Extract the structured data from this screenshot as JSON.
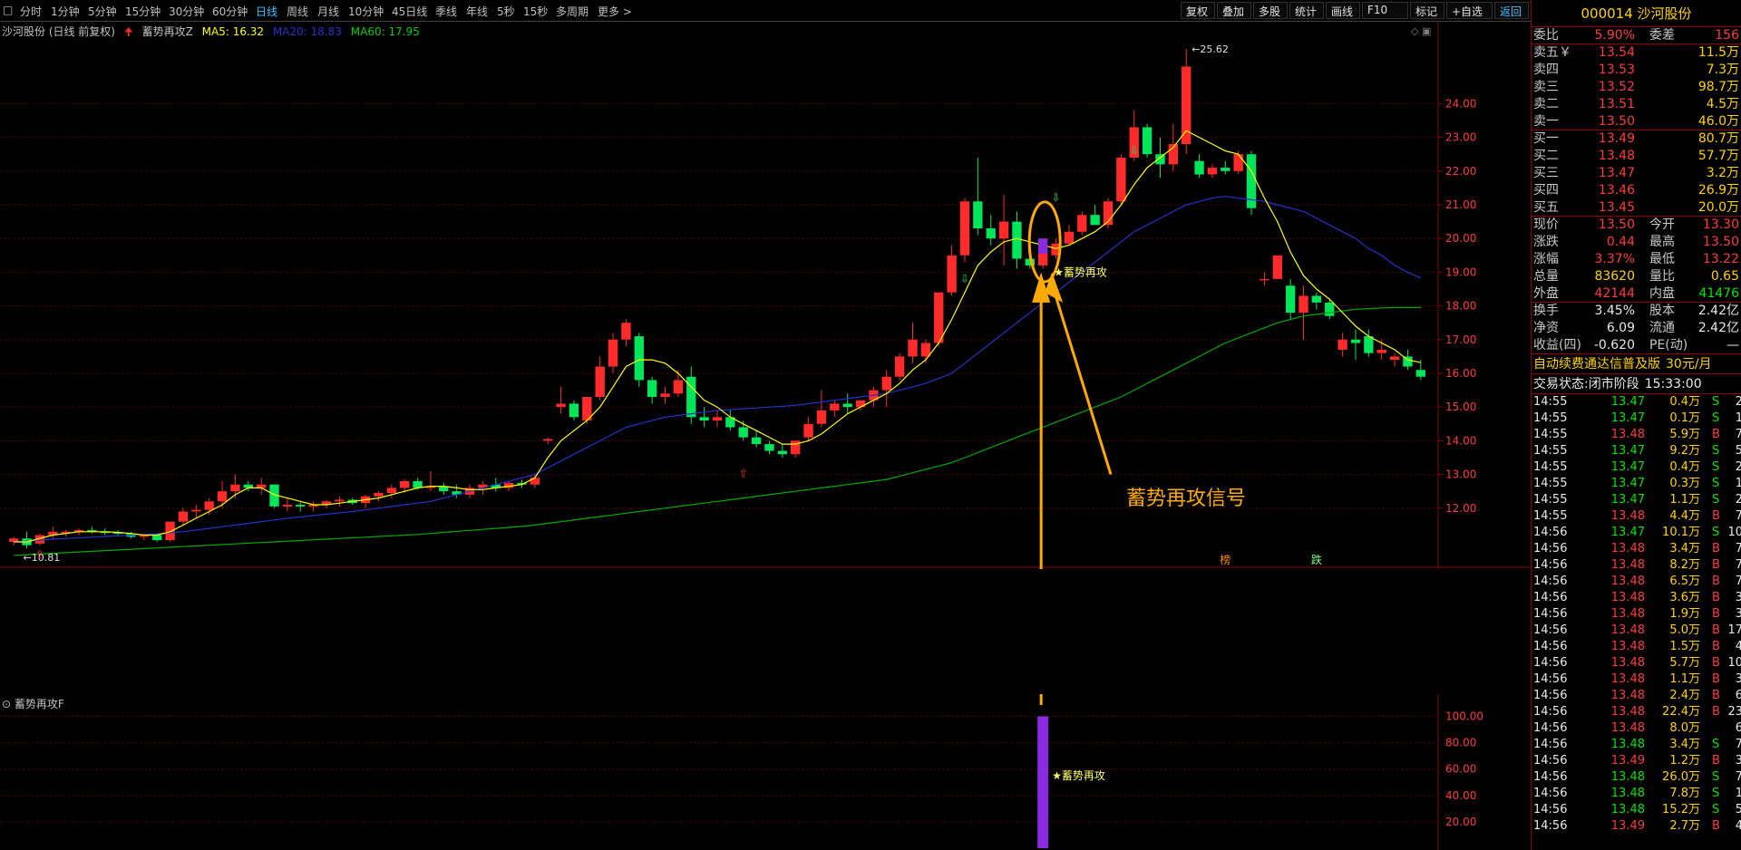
{
  "toolbar": {
    "menu_glyph": "□",
    "periods": [
      "分时",
      "1分钟",
      "5分钟",
      "15分钟",
      "30分钟",
      "60分钟",
      "日线",
      "周线",
      "月线",
      "10分钟",
      "45日线",
      "季线",
      "年线",
      "5秒",
      "15秒",
      "多周期",
      "更多 >"
    ],
    "active_period": "日线",
    "right_buttons": [
      "复权",
      "叠加",
      "多股",
      "统计",
      "画线",
      "F10",
      "标记",
      "+自选",
      "返回"
    ]
  },
  "legend": {
    "stock": "沙河股份 (日线 前复权)",
    "indicator": "蓄势再攻Z",
    "ma5": "MA5: 16.32",
    "ma20": "MA20: 18.83",
    "ma60": "MA60: 17.95"
  },
  "sub_legend": {
    "name": "蓄势再攻F"
  },
  "annotations": {
    "high_label": "25.62",
    "low_label": "10.81",
    "signal_main": "蓄势再攻",
    "signal_sub": "蓄势再攻",
    "callout": "蓄势再攻信号",
    "mark_bang": "榜",
    "mark_die": "跌"
  },
  "colors": {
    "up": "#ff2a2a",
    "down": "#00e65a",
    "ma5": "#ffff00",
    "ma20": "#2233cc",
    "ma60": "#00aa00",
    "signal": "#8a2be2",
    "callout": "#ffaa00"
  },
  "chart_data": {
    "type": "candlestick",
    "y_ticks": [
      "24.00",
      "23.00",
      "22.00",
      "21.00",
      "20.00",
      "19.00",
      "18.00",
      "17.00",
      "16.00",
      "15.00",
      "14.00",
      "13.00",
      "12.00"
    ],
    "sub_y_ticks": [
      "100.00",
      "80.00",
      "60.00",
      "40.00",
      "20.00"
    ],
    "candles": [
      [
        11.0,
        11.15,
        10.9,
        11.1
      ],
      [
        11.1,
        11.3,
        10.81,
        10.9
      ],
      [
        10.95,
        11.25,
        10.9,
        11.2
      ],
      [
        11.2,
        11.45,
        11.1,
        11.3
      ],
      [
        11.25,
        11.35,
        11.15,
        11.3
      ],
      [
        11.3,
        11.4,
        11.2,
        11.35
      ],
      [
        11.35,
        11.45,
        11.25,
        11.3
      ],
      [
        11.3,
        11.4,
        11.2,
        11.28
      ],
      [
        11.28,
        11.35,
        11.2,
        11.25
      ],
      [
        11.25,
        11.3,
        11.1,
        11.15
      ],
      [
        11.15,
        11.25,
        11.05,
        11.2
      ],
      [
        11.2,
        11.25,
        11.0,
        11.05
      ],
      [
        11.05,
        11.6,
        11.0,
        11.6
      ],
      [
        11.6,
        12.0,
        11.5,
        11.9
      ],
      [
        11.9,
        12.1,
        11.7,
        11.95
      ],
      [
        11.95,
        12.3,
        11.8,
        12.2
      ],
      [
        12.2,
        12.8,
        12.0,
        12.5
      ],
      [
        12.5,
        13.0,
        12.3,
        12.7
      ],
      [
        12.7,
        12.8,
        12.5,
        12.6
      ],
      [
        12.6,
        12.9,
        12.4,
        12.7
      ],
      [
        12.7,
        12.7,
        12.0,
        12.05
      ],
      [
        12.05,
        12.3,
        11.9,
        12.1
      ],
      [
        12.1,
        12.2,
        11.9,
        12.05
      ],
      [
        12.05,
        12.2,
        11.9,
        12.1
      ],
      [
        12.1,
        12.25,
        12.0,
        12.2
      ],
      [
        12.2,
        12.35,
        12.05,
        12.25
      ],
      [
        12.25,
        12.3,
        12.1,
        12.15
      ],
      [
        12.15,
        12.4,
        12.0,
        12.35
      ],
      [
        12.35,
        12.5,
        12.2,
        12.45
      ],
      [
        12.45,
        12.7,
        12.3,
        12.6
      ],
      [
        12.6,
        12.85,
        12.45,
        12.8
      ],
      [
        12.8,
        12.9,
        12.55,
        12.6
      ],
      [
        12.6,
        13.1,
        12.5,
        12.65
      ],
      [
        12.65,
        12.75,
        12.4,
        12.5
      ],
      [
        12.5,
        12.7,
        12.3,
        12.4
      ],
      [
        12.4,
        12.7,
        12.3,
        12.6
      ],
      [
        12.6,
        12.8,
        12.4,
        12.7
      ],
      [
        12.7,
        12.9,
        12.5,
        12.6
      ],
      [
        12.6,
        12.8,
        12.5,
        12.75
      ],
      [
        12.75,
        12.85,
        12.6,
        12.7
      ],
      [
        12.7,
        13.0,
        12.6,
        12.9
      ],
      [
        14.0,
        14.1,
        13.9,
        14.05
      ],
      [
        15.0,
        15.6,
        14.8,
        15.1
      ],
      [
        15.1,
        15.2,
        14.6,
        14.7
      ],
      [
        14.6,
        15.3,
        14.5,
        15.3
      ],
      [
        15.3,
        16.5,
        15.2,
        16.2
      ],
      [
        16.2,
        17.2,
        16.0,
        17.0
      ],
      [
        17.0,
        17.6,
        16.8,
        17.5
      ],
      [
        17.1,
        17.2,
        15.6,
        15.8
      ],
      [
        15.8,
        15.9,
        15.1,
        15.3
      ],
      [
        15.3,
        15.6,
        15.1,
        15.4
      ],
      [
        15.4,
        16.1,
        15.3,
        15.8
      ],
      [
        15.9,
        16.2,
        14.5,
        14.7
      ],
      [
        14.7,
        15.0,
        14.4,
        14.6
      ],
      [
        14.6,
        14.9,
        14.4,
        14.7
      ],
      [
        14.7,
        14.9,
        14.3,
        14.4
      ],
      [
        14.4,
        14.6,
        14.0,
        14.1
      ],
      [
        14.1,
        14.3,
        13.8,
        13.9
      ],
      [
        13.9,
        14.0,
        13.6,
        13.7
      ],
      [
        13.7,
        13.9,
        13.5,
        13.6
      ],
      [
        13.6,
        14.0,
        13.5,
        14.0
      ],
      [
        14.1,
        14.7,
        14.0,
        14.5
      ],
      [
        14.5,
        15.5,
        14.4,
        14.9
      ],
      [
        14.9,
        15.2,
        14.7,
        15.1
      ],
      [
        15.1,
        15.4,
        14.8,
        15.0
      ],
      [
        15.0,
        15.2,
        14.9,
        15.2
      ],
      [
        15.2,
        15.6,
        15.0,
        15.5
      ],
      [
        15.5,
        16.1,
        15.0,
        15.9
      ],
      [
        15.9,
        16.6,
        15.8,
        16.5
      ],
      [
        16.5,
        17.5,
        16.3,
        17.0
      ],
      [
        16.5,
        17.0,
        16.3,
        16.9
      ],
      [
        16.9,
        18.4,
        16.8,
        18.4
      ],
      [
        18.4,
        19.8,
        18.3,
        19.5
      ],
      [
        19.5,
        21.2,
        19.3,
        21.1
      ],
      [
        21.1,
        22.4,
        20.1,
        20.3
      ],
      [
        20.3,
        20.7,
        19.8,
        20.0
      ],
      [
        20.0,
        21.3,
        19.2,
        20.5
      ],
      [
        20.5,
        20.8,
        19.1,
        19.4
      ],
      [
        19.4,
        19.5,
        19.1,
        19.2
      ],
      [
        19.2,
        20.0,
        19.1,
        19.8
      ],
      [
        19.5,
        20.0,
        19.4,
        19.85
      ],
      [
        19.85,
        20.4,
        19.8,
        20.2
      ],
      [
        20.2,
        20.8,
        20.1,
        20.7
      ],
      [
        20.7,
        21.0,
        20.5,
        20.4
      ],
      [
        20.4,
        21.2,
        20.3,
        21.1
      ],
      [
        21.1,
        22.5,
        21.0,
        22.4
      ],
      [
        22.4,
        23.8,
        22.3,
        23.3
      ],
      [
        23.3,
        23.4,
        22.4,
        22.5
      ],
      [
        22.5,
        23.0,
        21.8,
        22.2
      ],
      [
        22.2,
        23.4,
        22.0,
        22.8
      ],
      [
        22.8,
        25.62,
        22.5,
        25.1
      ],
      [
        22.3,
        22.5,
        21.8,
        21.9
      ],
      [
        21.9,
        22.2,
        21.8,
        22.1
      ],
      [
        22.1,
        22.3,
        21.9,
        22.0
      ],
      [
        22.0,
        22.6,
        21.9,
        22.5
      ],
      [
        22.5,
        22.6,
        20.7,
        20.9
      ],
      [
        18.8,
        19.0,
        18.6,
        18.8
      ],
      [
        18.8,
        19.2,
        18.8,
        19.5
      ],
      [
        18.6,
        18.8,
        17.6,
        17.8
      ],
      [
        17.8,
        18.6,
        17.0,
        18.3
      ],
      [
        18.3,
        18.4,
        17.9,
        18.1
      ],
      [
        18.1,
        18.2,
        17.6,
        17.7
      ],
      [
        16.7,
        17.2,
        16.5,
        17.0
      ],
      [
        17.0,
        17.3,
        16.4,
        16.9
      ],
      [
        17.1,
        17.3,
        16.5,
        16.6
      ],
      [
        16.6,
        17.0,
        16.4,
        16.7
      ],
      [
        16.4,
        16.6,
        16.2,
        16.5
      ],
      [
        16.5,
        16.7,
        16.1,
        16.2
      ],
      [
        16.1,
        16.4,
        15.8,
        15.9
      ]
    ],
    "ma5": [
      11.0,
      11.0,
      11.1,
      11.2,
      11.25,
      11.3,
      11.3,
      11.3,
      11.28,
      11.25,
      11.2,
      11.2,
      11.3,
      11.5,
      11.7,
      11.9,
      12.1,
      12.4,
      12.6,
      12.6,
      12.4,
      12.3,
      12.2,
      12.1,
      12.1,
      12.15,
      12.2,
      12.25,
      12.3,
      12.4,
      12.5,
      12.6,
      12.65,
      12.65,
      12.6,
      12.55,
      12.55,
      12.6,
      12.65,
      12.7,
      12.9,
      13.5,
      14.0,
      14.3,
      14.6,
      15.0,
      15.6,
      16.2,
      16.4,
      16.4,
      16.3,
      16.0,
      15.6,
      15.2,
      15.0,
      14.7,
      14.5,
      14.3,
      14.1,
      13.9,
      13.9,
      14.0,
      14.2,
      14.5,
      14.8,
      15.0,
      15.2,
      15.4,
      15.7,
      16.1,
      16.4,
      16.9,
      17.6,
      18.4,
      19.2,
      19.6,
      19.9,
      20.0,
      19.9,
      19.8,
      19.7,
      19.8,
      20.0,
      20.2,
      20.5,
      21.0,
      21.6,
      22.1,
      22.4,
      22.7,
      23.2,
      23.0,
      22.8,
      22.6,
      22.5,
      22.0,
      21.2,
      20.5,
      19.6,
      18.9,
      18.5,
      18.2,
      17.8,
      17.4,
      17.1,
      16.9,
      16.7,
      16.4,
      16.32
    ],
    "ma20": [
      11.0,
      11.02,
      11.05,
      11.08,
      11.1,
      11.12,
      11.14,
      11.16,
      11.18,
      11.2,
      11.22,
      11.24,
      11.27,
      11.3,
      11.35,
      11.4,
      11.45,
      11.5,
      11.55,
      11.6,
      11.65,
      11.7,
      11.74,
      11.78,
      11.82,
      11.86,
      11.9,
      11.95,
      12.0,
      12.05,
      12.1,
      12.15,
      12.2,
      12.3,
      12.4,
      12.5,
      12.6,
      12.7,
      12.8,
      12.9,
      13.0,
      13.2,
      13.4,
      13.6,
      13.8,
      14.0,
      14.2,
      14.4,
      14.5,
      14.6,
      14.7,
      14.75,
      14.8,
      14.85,
      14.9,
      14.92,
      14.95,
      14.97,
      15.0,
      15.02,
      15.05,
      15.1,
      15.15,
      15.2,
      15.25,
      15.3,
      15.35,
      15.4,
      15.5,
      15.6,
      15.7,
      15.85,
      16.0,
      16.3,
      16.6,
      16.9,
      17.2,
      17.5,
      17.8,
      18.1,
      18.4,
      18.7,
      19.0,
      19.3,
      19.6,
      19.9,
      20.2,
      20.4,
      20.6,
      20.8,
      21.0,
      21.1,
      21.2,
      21.25,
      21.2,
      21.15,
      21.1,
      21.0,
      20.9,
      20.8,
      20.6,
      20.4,
      20.2,
      20.0,
      19.7,
      19.5,
      19.2,
      19.0,
      18.83
    ],
    "ma60": [
      10.6,
      10.62,
      10.64,
      10.66,
      10.68,
      10.7,
      10.72,
      10.74,
      10.76,
      10.78,
      10.8,
      10.82,
      10.84,
      10.86,
      10.88,
      10.9,
      10.92,
      10.94,
      10.96,
      10.98,
      11.0,
      11.02,
      11.04,
      11.06,
      11.08,
      11.1,
      11.12,
      11.14,
      11.16,
      11.18,
      11.2,
      11.22,
      11.25,
      11.28,
      11.31,
      11.34,
      11.37,
      11.4,
      11.43,
      11.46,
      11.5,
      11.55,
      11.6,
      11.65,
      11.7,
      11.75,
      11.8,
      11.85,
      11.9,
      11.95,
      12.0,
      12.05,
      12.1,
      12.15,
      12.2,
      12.25,
      12.3,
      12.35,
      12.4,
      12.45,
      12.5,
      12.55,
      12.6,
      12.65,
      12.7,
      12.75,
      12.8,
      12.85,
      12.95,
      13.05,
      13.15,
      13.25,
      13.35,
      13.5,
      13.65,
      13.8,
      13.95,
      14.1,
      14.25,
      14.4,
      14.55,
      14.7,
      14.85,
      15.0,
      15.15,
      15.3,
      15.5,
      15.7,
      15.9,
      16.1,
      16.3,
      16.5,
      16.7,
      16.9,
      17.05,
      17.2,
      17.35,
      17.5,
      17.6,
      17.7,
      17.75,
      17.8,
      17.85,
      17.9,
      17.92,
      17.94,
      17.95,
      17.95,
      17.95
    ],
    "signal_bar_value": 100
  },
  "panel": {
    "title": "000014 沙河股份",
    "weibi": {
      "label": "委比",
      "value": "5.90%",
      "label2": "委差",
      "value2": "156"
    },
    "asks": [
      {
        "label": "卖五￥",
        "price": "13.54",
        "vol": "11.5万"
      },
      {
        "label": "卖四",
        "price": "13.53",
        "vol": "7.3万"
      },
      {
        "label": "卖三",
        "price": "13.52",
        "vol": "98.7万"
      },
      {
        "label": "卖二",
        "price": "13.51",
        "vol": "4.5万"
      },
      {
        "label": "卖一",
        "price": "13.50",
        "vol": "46.0万"
      }
    ],
    "bids": [
      {
        "label": "买一",
        "price": "13.49",
        "vol": "80.7万"
      },
      {
        "label": "买二",
        "price": "13.48",
        "vol": "57.7万"
      },
      {
        "label": "买三",
        "price": "13.47",
        "vol": "3.2万"
      },
      {
        "label": "买四",
        "price": "13.46",
        "vol": "26.9万"
      },
      {
        "label": "买五",
        "price": "13.45",
        "vol": "20.0万"
      }
    ],
    "quote": [
      {
        "l1": "现价",
        "v1": "13.50",
        "l2": "今开",
        "v2": "13.30",
        "c1": "red",
        "c2": "red"
      },
      {
        "l1": "涨跌",
        "v1": "0.44",
        "l2": "最高",
        "v2": "13.50",
        "c1": "red",
        "c2": "red"
      },
      {
        "l1": "涨幅",
        "v1": "3.37%",
        "l2": "最低",
        "v2": "13.22",
        "c1": "red",
        "c2": "red"
      },
      {
        "l1": "总量",
        "v1": "83620",
        "l2": "量比",
        "v2": "0.65",
        "c1": "yellow",
        "c2": "yellow"
      },
      {
        "l1": "外盘",
        "v1": "42144",
        "l2": "内盘",
        "v2": "41476",
        "c1": "red",
        "c2": "green"
      }
    ],
    "fund": [
      {
        "l1": "换手",
        "v1": "3.45%",
        "l2": "股本",
        "v2": "2.42亿"
      },
      {
        "l1": "净资",
        "v1": "6.09",
        "l2": "流通",
        "v2": "2.42亿"
      },
      {
        "l1": "收益(四)",
        "v1": "-0.620",
        "l2": "PE(动)",
        "v2": "—"
      }
    ],
    "promo": {
      "text": "自动续费通达信普及版",
      "price": "30元/月"
    },
    "status": {
      "label": "交易状态:",
      "value": "闭市阶段",
      "time": "15:33:00"
    },
    "ticks": [
      [
        "14:55",
        "13.47",
        "0.4万",
        "S",
        "2",
        "green"
      ],
      [
        "14:55",
        "13.47",
        "0.1万",
        "S",
        "1",
        "green"
      ],
      [
        "14:55",
        "13.48",
        "5.9万",
        "B",
        "7",
        "red"
      ],
      [
        "14:55",
        "13.47",
        "9.2万",
        "S",
        "5",
        "green"
      ],
      [
        "14:55",
        "13.47",
        "0.4万",
        "S",
        "2",
        "green"
      ],
      [
        "14:55",
        "13.47",
        "0.3万",
        "S",
        "1",
        "green"
      ],
      [
        "14:55",
        "13.47",
        "1.1万",
        "S",
        "2",
        "green"
      ],
      [
        "14:55",
        "13.48",
        "4.4万",
        "B",
        "7",
        "red"
      ],
      [
        "14:56",
        "13.47",
        "10.1万",
        "S",
        "10",
        "green"
      ],
      [
        "14:56",
        "13.48",
        "3.4万",
        "B",
        "7",
        "red"
      ],
      [
        "14:56",
        "13.48",
        "8.2万",
        "B",
        "7",
        "red"
      ],
      [
        "14:56",
        "13.48",
        "6.5万",
        "B",
        "7",
        "red"
      ],
      [
        "14:56",
        "13.48",
        "3.6万",
        "B",
        "3",
        "red"
      ],
      [
        "14:56",
        "13.48",
        "1.9万",
        "B",
        "3",
        "red"
      ],
      [
        "14:56",
        "13.48",
        "5.0万",
        "B",
        "17",
        "red"
      ],
      [
        "14:56",
        "13.48",
        "1.5万",
        "B",
        "4",
        "red"
      ],
      [
        "14:56",
        "13.48",
        "5.7万",
        "B",
        "10",
        "red"
      ],
      [
        "14:56",
        "13.48",
        "1.1万",
        "B",
        "3",
        "red"
      ],
      [
        "14:56",
        "13.48",
        "2.4万",
        "B",
        "6",
        "red"
      ],
      [
        "14:56",
        "13.48",
        "22.4万",
        "B",
        "23",
        "red"
      ],
      [
        "14:56",
        "13.48",
        "8.0万",
        "",
        "6",
        "red"
      ],
      [
        "14:56",
        "13.48",
        "3.4万",
        "S",
        "7",
        "green"
      ],
      [
        "14:56",
        "13.49",
        "1.2万",
        "B",
        "3",
        "red"
      ],
      [
        "14:56",
        "13.48",
        "26.0万",
        "S",
        "7",
        "green"
      ],
      [
        "14:56",
        "13.48",
        "7.8万",
        "S",
        "1",
        "green"
      ],
      [
        "14:56",
        "13.48",
        "15.2万",
        "S",
        "5",
        "green"
      ],
      [
        "14:56",
        "13.49",
        "2.7万",
        "B",
        "4",
        "red"
      ]
    ]
  }
}
